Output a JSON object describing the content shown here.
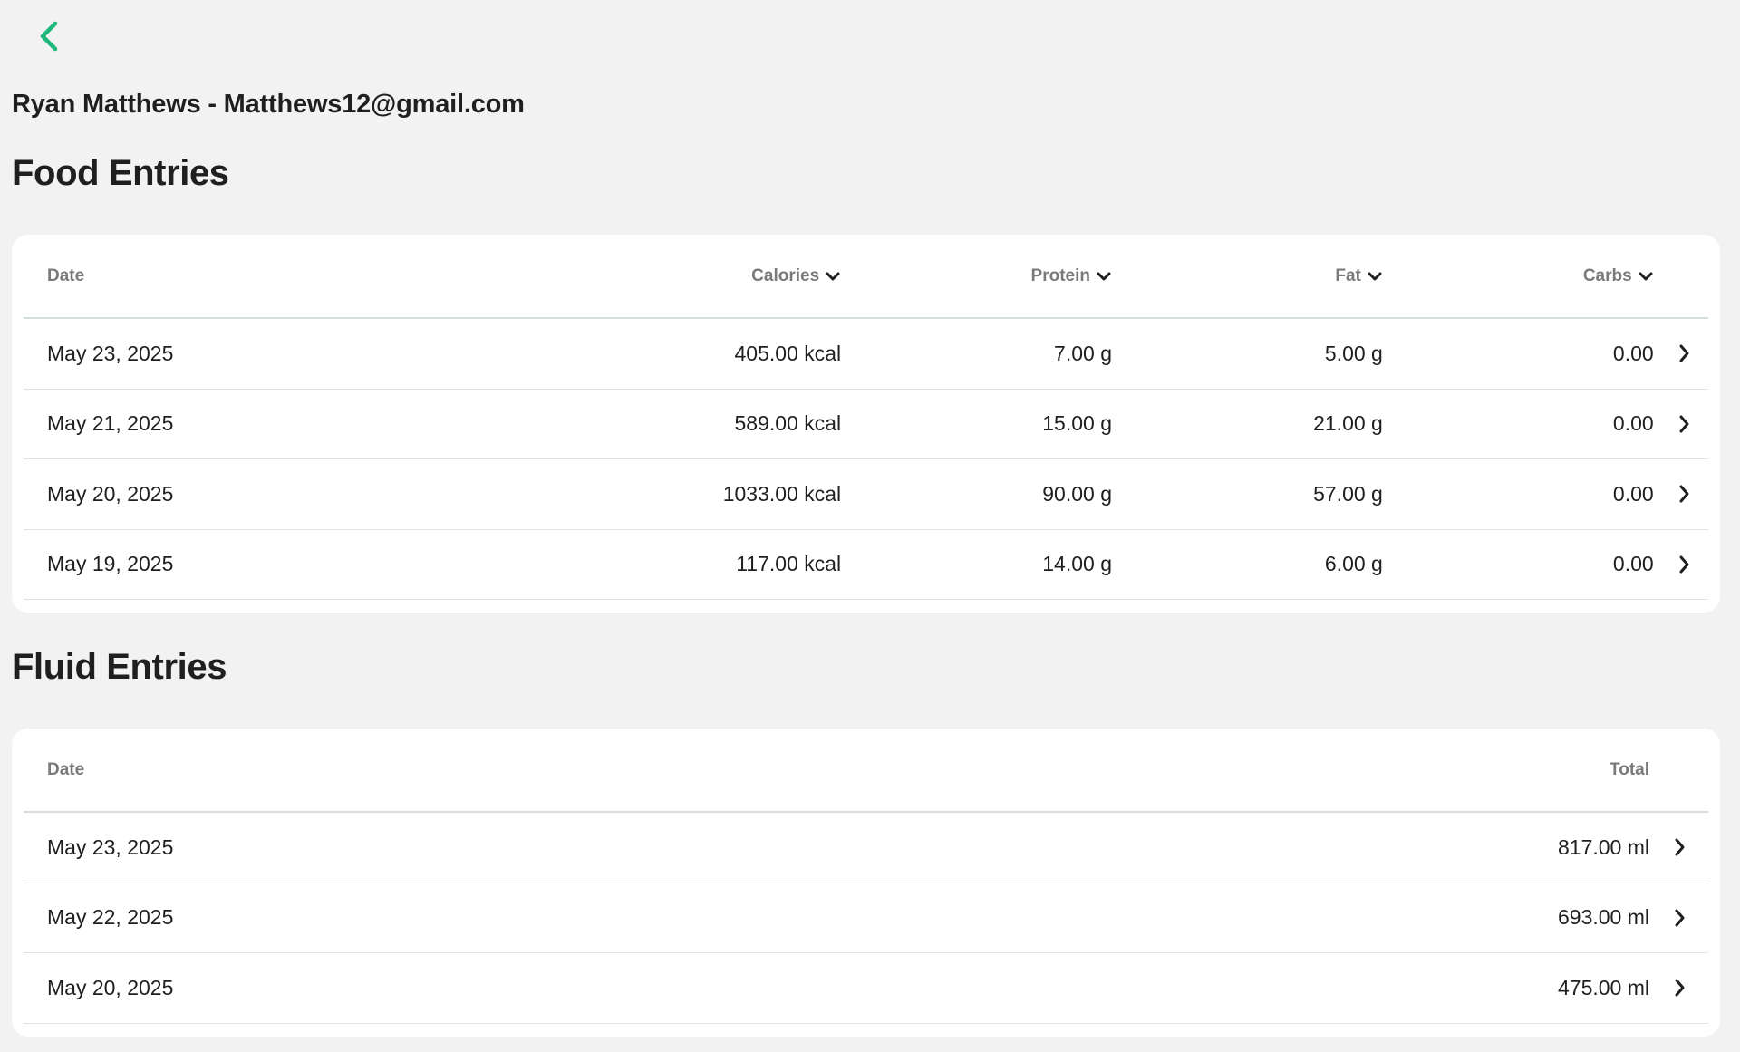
{
  "header": {
    "user_line": "Ryan Matthews - Matthews12@gmail.com",
    "back_icon": "chevron-left-icon",
    "accent_color": "#1db87a"
  },
  "food": {
    "title": "Food Entries",
    "columns": {
      "date": "Date",
      "calories": "Calories",
      "protein": "Protein",
      "fat": "Fat",
      "carbs": "Carbs"
    },
    "rows": [
      {
        "date": "May 23, 2025",
        "calories": "405.00 kcal",
        "protein": "7.00 g",
        "fat": "5.00 g",
        "carbs": "0.00"
      },
      {
        "date": "May 21, 2025",
        "calories": "589.00 kcal",
        "protein": "15.00 g",
        "fat": "21.00 g",
        "carbs": "0.00"
      },
      {
        "date": "May 20, 2025",
        "calories": "1033.00 kcal",
        "protein": "90.00 g",
        "fat": "57.00 g",
        "carbs": "0.00"
      },
      {
        "date": "May 19, 2025",
        "calories": "117.00 kcal",
        "protein": "14.00 g",
        "fat": "6.00 g",
        "carbs": "0.00"
      }
    ]
  },
  "fluid": {
    "title": "Fluid Entries",
    "columns": {
      "date": "Date",
      "total": "Total"
    },
    "rows": [
      {
        "date": "May 23, 2025",
        "total": "817.00 ml"
      },
      {
        "date": "May 22, 2025",
        "total": "693.00 ml"
      },
      {
        "date": "May 20, 2025",
        "total": "475.00 ml"
      }
    ]
  }
}
